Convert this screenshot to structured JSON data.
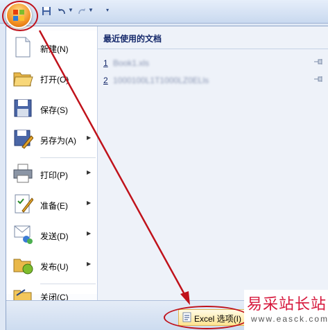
{
  "quick_access": {
    "icons": [
      "office-logo-icon",
      "save-icon",
      "undo-icon",
      "redo-icon",
      "customize-icon"
    ]
  },
  "menu": {
    "items": [
      {
        "label": "新建(N)",
        "icon": "new-document-icon",
        "has_submenu": false
      },
      {
        "label": "打开(O)",
        "icon": "open-folder-icon",
        "has_submenu": false
      },
      {
        "label": "保存(S)",
        "icon": "save-icon",
        "has_submenu": false
      },
      {
        "label": "另存为(A)",
        "icon": "save-as-icon",
        "has_submenu": true
      },
      {
        "label": "打印(P)",
        "icon": "printer-icon",
        "has_submenu": true
      },
      {
        "label": "准备(E)",
        "icon": "prepare-icon",
        "has_submenu": true
      },
      {
        "label": "发送(D)",
        "icon": "send-icon",
        "has_submenu": true
      },
      {
        "label": "发布(U)",
        "icon": "publish-icon",
        "has_submenu": true
      },
      {
        "label": "关闭(C)",
        "icon": "close-folder-icon",
        "has_submenu": false
      }
    ]
  },
  "recent": {
    "title": "最近使用的文档",
    "docs": [
      {
        "num": "1",
        "name": "Book1.xls"
      },
      {
        "num": "2",
        "name": "1000100L1T1000LZ0ELls"
      }
    ]
  },
  "footer": {
    "options_label": "Excel 选项(I)"
  },
  "watermark": {
    "text": "易采站长站",
    "url": "www.easck.com"
  },
  "colors": {
    "annotation": "#c0121b",
    "accent_orange": "#f08a1c"
  }
}
